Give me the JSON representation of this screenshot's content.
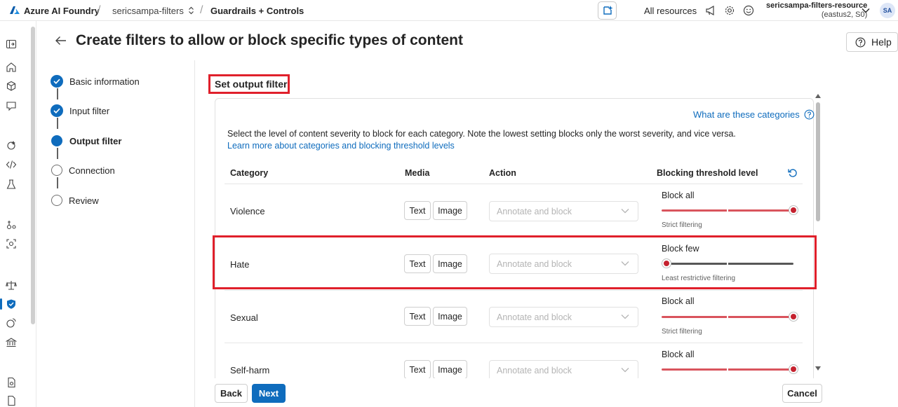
{
  "topbar": {
    "brand": "Azure AI Foundry",
    "project": "sericsampa-filters",
    "page": "Guardrails + Controls",
    "all_resources": "All resources",
    "account_name": "sericsampa-filters-resource",
    "account_region": "(eastus2, S0)",
    "avatar_initials": "SA"
  },
  "header": {
    "title": "Create filters to allow or block specific types of content",
    "help_label": "Help"
  },
  "steps": [
    {
      "label": "Basic information",
      "state": "done"
    },
    {
      "label": "Input filter",
      "state": "done"
    },
    {
      "label": "Output filter",
      "state": "current"
    },
    {
      "label": "Connection",
      "state": "todo"
    },
    {
      "label": "Review",
      "state": "todo"
    }
  ],
  "section": {
    "title": "Set output filter",
    "what_link": "What are these categories",
    "description": "Select the level of content severity to block for each category. Note the lowest setting blocks only the worst severity, and vice versa.",
    "learn_link": "Learn more about categories and blocking threshold levels",
    "columns": {
      "category": "Category",
      "media": "Media",
      "action": "Action",
      "threshold": "Blocking threshold level"
    },
    "rows": [
      {
        "category": "Violence",
        "media": [
          "Text",
          "Image"
        ],
        "action": "Annotate and block",
        "level": "Block all",
        "caption": "Strict filtering",
        "slider_value": 1.0
      },
      {
        "category": "Hate",
        "media": [
          "Text",
          "Image"
        ],
        "action": "Annotate and block",
        "level": "Block few",
        "caption": "Least restrictive filtering",
        "slider_value": 0.0
      },
      {
        "category": "Sexual",
        "media": [
          "Text",
          "Image"
        ],
        "action": "Annotate and block",
        "level": "Block all",
        "caption": "Strict filtering",
        "slider_value": 1.0
      },
      {
        "category": "Self-harm",
        "media": [
          "Text",
          "Image"
        ],
        "action": "Annotate and block",
        "level": "Block all",
        "caption": "",
        "slider_value": 1.0
      }
    ]
  },
  "footer": {
    "back": "Back",
    "next": "Next",
    "cancel": "Cancel"
  },
  "colors": {
    "accent": "#0f6cbd",
    "highlight": "#e0202b",
    "slider_active": "#d9545d",
    "slider_inactive": "#575757"
  }
}
